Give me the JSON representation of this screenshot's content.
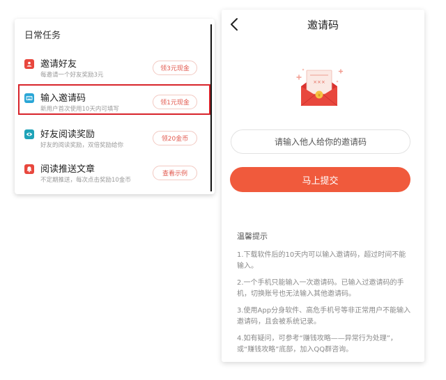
{
  "daily_tasks": {
    "title": "日常任务",
    "items": [
      {
        "title": "邀请好友",
        "subtitle": "每邀请一个好友奖励3元",
        "button": "领3元现金",
        "icon": "user-card-icon",
        "icon_color": "#e8473d"
      },
      {
        "title": "输入邀请码",
        "subtitle": "新用户首次使用10天内可填写",
        "button": "领1元现金",
        "icon": "keyboard-icon",
        "icon_color": "#2aa6d6"
      },
      {
        "title": "好友阅读奖励",
        "subtitle": "好友的阅读奖励，双倍奖励给你",
        "button": "领20金币",
        "icon": "eye-icon",
        "icon_color": "#1fa3b8"
      },
      {
        "title": "阅读推送文章",
        "subtitle": "不定期推送，每次点击奖励10金币",
        "button": "查看示例",
        "icon": "bell-icon",
        "icon_color": "#e8473d"
      }
    ],
    "highlighted_index": 1
  },
  "invite_page": {
    "title": "邀请码",
    "back_icon": "chevron-left-icon",
    "input_placeholder": "请输入他人给你的邀请码",
    "submit_label": "马上提交",
    "tips_title": "温馨提示",
    "tips": [
      "1.下载软件后的10天内可以输入邀请码，超过时间不能输入。",
      "2.一个手机只能输入一次邀请码。已输入过邀请码的手机，切换账号也无法输入其他邀请码。",
      "3.使用App分身软件、高危手机号等非正常用户不能输入邀请码，且会被系统记录。",
      "4.如有疑问，可参考“赚钱攻略——异常行为处理”，或“赚钱攻略”底部，加入QQ群咨询。"
    ]
  },
  "colors": {
    "accent": "#f05a3c",
    "highlight_border": "#d8232a",
    "button_text": "#e2574c"
  }
}
